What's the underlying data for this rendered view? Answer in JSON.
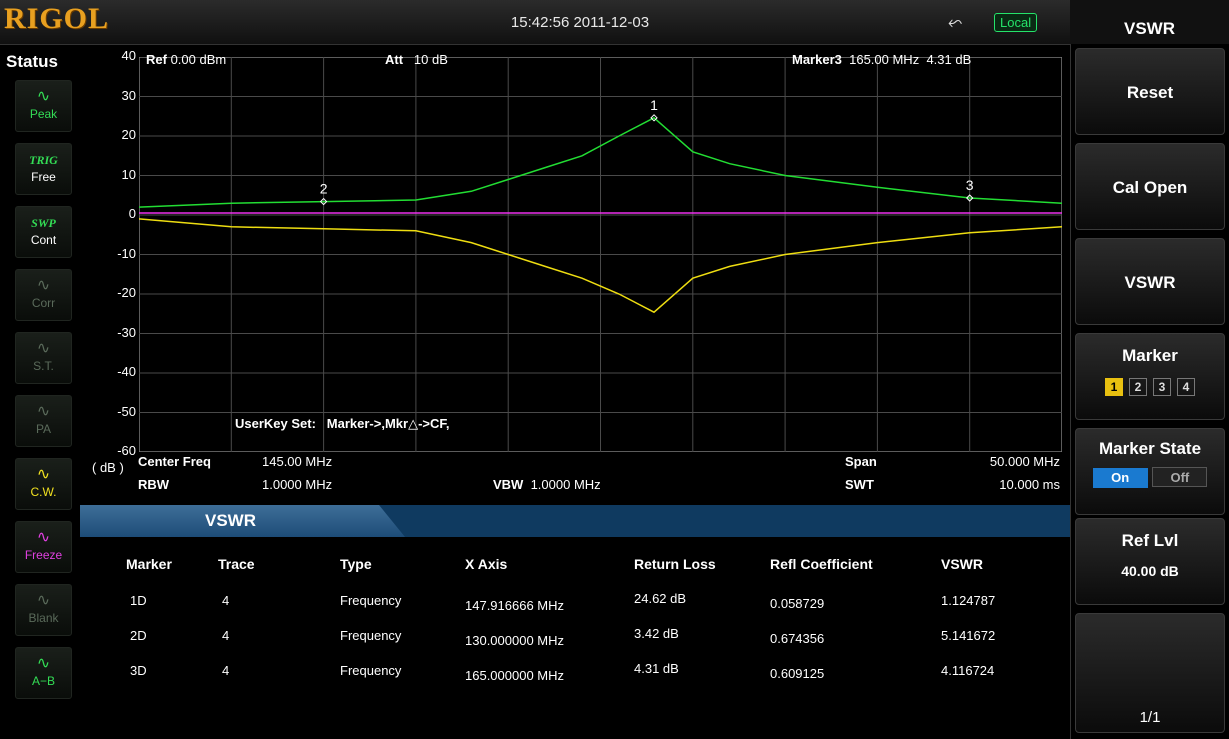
{
  "header": {
    "logo": "RIGOL",
    "datetime": "15:42:56 2011-12-03",
    "usb_icon": "usb-icon",
    "remote_status": "Local"
  },
  "status": {
    "title": "Status",
    "items": [
      {
        "label": "Peak",
        "icon": "peak-icon",
        "color": "#33dd55"
      },
      {
        "label": "Free",
        "badge": "TRIG",
        "color": "#33dd55"
      },
      {
        "label": "Cont",
        "badge": "SWP",
        "color": "#33dd55"
      },
      {
        "label": "Corr",
        "icon": "corr-icon",
        "color": "#5a6a5a"
      },
      {
        "label": "S.T.",
        "icon": "st-icon",
        "color": "#5a6a5a"
      },
      {
        "label": "PA",
        "icon": "pa-icon",
        "color": "#5a6a5a"
      },
      {
        "label": "C.W.",
        "icon": "cw-icon",
        "color": "#f0e020"
      },
      {
        "label": "Freeze",
        "icon": "freeze-icon",
        "color": "#e040e0"
      },
      {
        "label": "Blank",
        "icon": "blank-icon",
        "color": "#5a6a5a"
      },
      {
        "label": "A−B",
        "icon": "a-minus-b-icon",
        "color": "#33dd55"
      }
    ]
  },
  "graph": {
    "ref_label": "Ref",
    "ref_value": "0.00 dBm",
    "att_label": "Att",
    "att_value": "10 dB",
    "marker_label": "Marker3",
    "marker_freq": "165.00 MHz",
    "marker_value": "4.31 dB",
    "unit": "( dB )",
    "userkey": "UserKey Set:",
    "userkey_value": "Marker->,Mkr△->CF,",
    "center_label": "Center Freq",
    "center_value": "145.00 MHz",
    "span_label": "Span",
    "span_value": "50.000 MHz",
    "rbw_label": "RBW",
    "rbw_value": "1.0000 MHz",
    "vbw_label": "VBW",
    "vbw_value": "1.0000 MHz",
    "swt_label": "SWT",
    "swt_value": "10.000 ms",
    "markers": [
      "1",
      "2",
      "3"
    ]
  },
  "chart_data": {
    "type": "line",
    "yticks": [
      "40",
      "30",
      "20",
      "10",
      "0",
      "-10",
      "-20",
      "-30",
      "-40",
      "-50",
      "-60"
    ],
    "ylim": [
      -60,
      40
    ],
    "xlim": [
      120,
      170
    ],
    "grid": true,
    "series": [
      {
        "color": "#22dd33",
        "x": [
          120,
          125,
          130,
          135,
          138,
          140,
          142,
          144,
          146,
          147.9,
          150,
          152,
          155,
          160,
          165,
          170
        ],
        "y": [
          2,
          3,
          3.4,
          3.8,
          6,
          9,
          12,
          15,
          20,
          24.6,
          16,
          13,
          10,
          7,
          4.3,
          3
        ]
      },
      {
        "color": "#ee30ee",
        "x": [
          120,
          170
        ],
        "y": [
          0.5,
          0.5
        ]
      },
      {
        "color": "#eedd11",
        "x": [
          120,
          125,
          130,
          135,
          138,
          140,
          142,
          144,
          146,
          147.9,
          150,
          152,
          155,
          160,
          165,
          170
        ],
        "y": [
          -1,
          -3,
          -3.5,
          -4,
          -7,
          -10,
          -13,
          -16,
          -20,
          -24.6,
          -16,
          -13,
          -10,
          -7,
          -4.5,
          -3
        ]
      }
    ],
    "marker_points": [
      {
        "label": "1",
        "x": 147.9,
        "y": 24.6
      },
      {
        "label": "2",
        "x": 130,
        "y": 3.4
      },
      {
        "label": "3",
        "x": 165,
        "y": 4.3
      }
    ]
  },
  "table": {
    "tab_label": "VSWR",
    "headers": [
      "Marker",
      "Trace",
      "Type",
      "X Axis",
      "Return Loss",
      "Refl Coefficient",
      "VSWR"
    ],
    "rows": [
      [
        "1D",
        "4",
        "Frequency",
        "147.916666 MHz",
        "24.62 dB",
        "0.058729",
        "1.124787"
      ],
      [
        "2D",
        "4",
        "Frequency",
        "130.000000 MHz",
        "3.42 dB",
        "0.674356",
        "5.141672"
      ],
      [
        "3D",
        "4",
        "Frequency",
        "165.000000 MHz",
        "4.31 dB",
        "0.609125",
        "4.116724"
      ]
    ]
  },
  "menu": {
    "title": "VSWR",
    "reset": "Reset",
    "cal_open": "Cal Open",
    "vswr": "VSWR",
    "marker": "Marker",
    "marker_options": [
      "1",
      "2",
      "3",
      "4"
    ],
    "marker_selected": "1",
    "marker_state": "Marker State",
    "on": "On",
    "off": "Off",
    "ref_lvl": "Ref Lvl",
    "ref_lvl_value": "40.00 dB",
    "page": "1/1"
  }
}
